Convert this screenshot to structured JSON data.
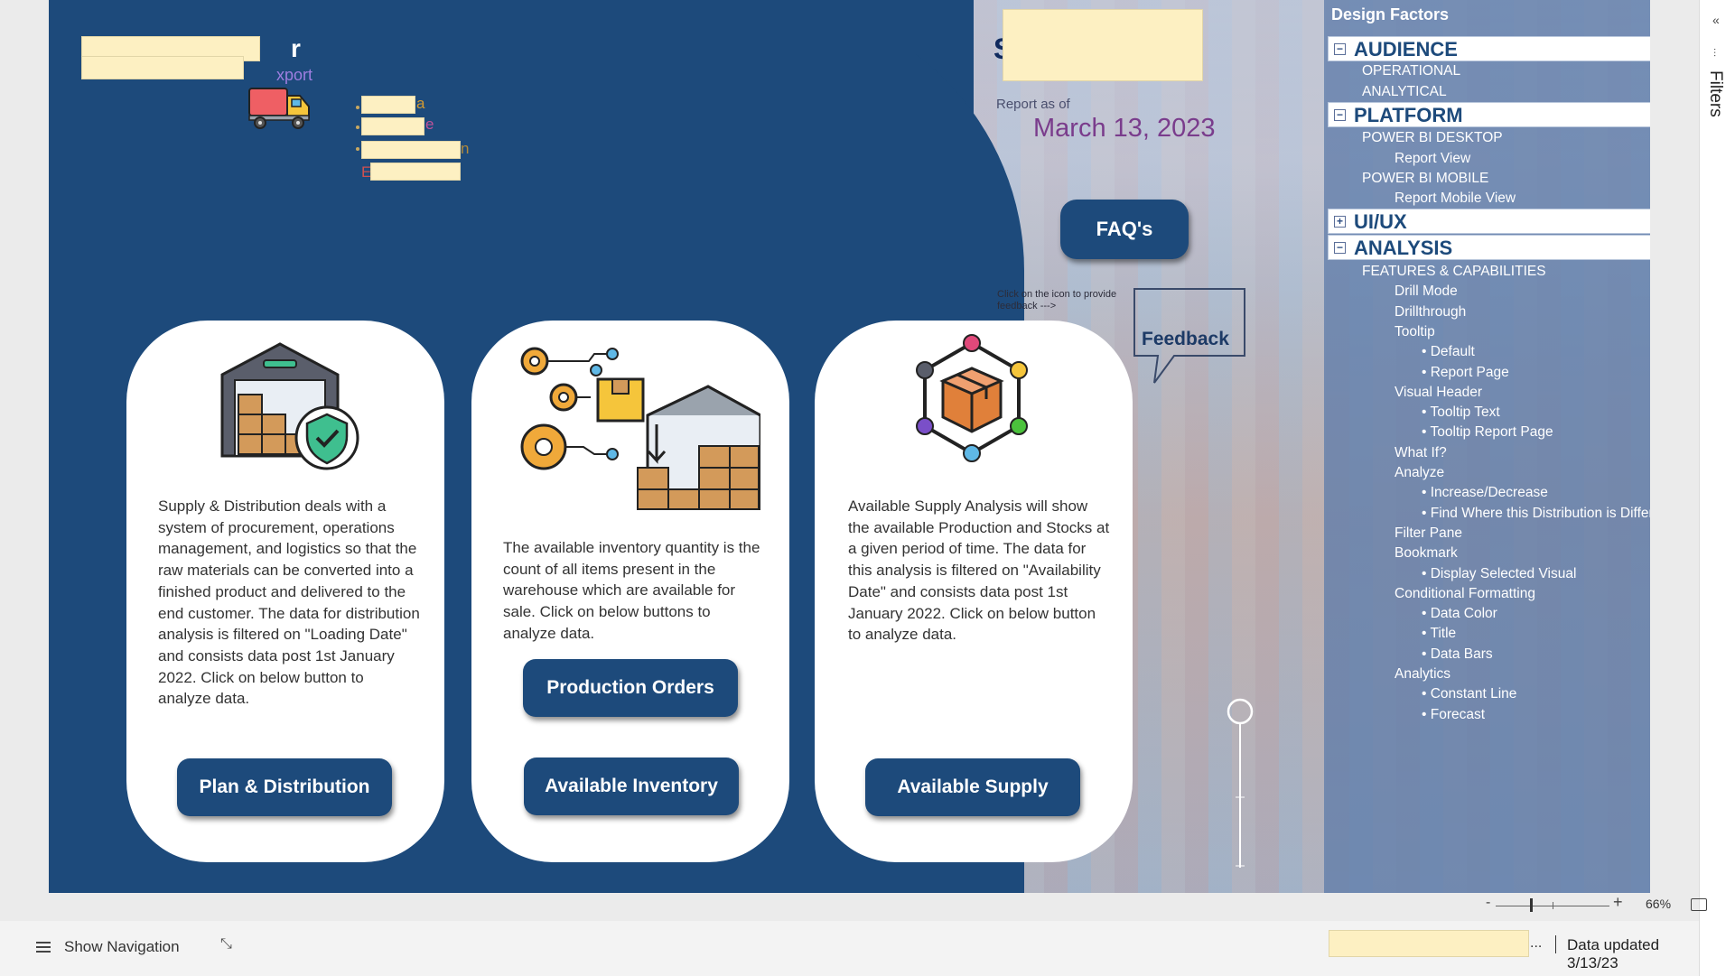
{
  "header": {
    "title_visible_tail": "r",
    "subtitle_visible_tail": "xport",
    "right_title_visible_char": "S",
    "legend_tails": [
      "a",
      "e",
      "n",
      "E"
    ],
    "report_as_of_label": "Report as of",
    "report_date": "March 13, 2023"
  },
  "faq_label": "FAQ's",
  "feedback": {
    "hint": "Click on the icon to provide feedback --->",
    "label": "Feedback"
  },
  "cards": [
    {
      "icon": "warehouse-shield-icon",
      "text": "Supply & Distribution deals with a system of procurement, operations management, and logistics so that the raw materials can be converted into a finished product and delivered to the end customer. The data for distribution analysis is filtered on \"Loading Date\" and consists data post 1st January 2022. Click on below button to analyze data.",
      "buttons": [
        "Plan & Distribution"
      ]
    },
    {
      "icon": "gears-warehouse-icon",
      "text": "The available inventory quantity is the count of all items present in the warehouse which are available for sale. Click on below buttons to analyze data.",
      "buttons": [
        "Production Orders",
        "Available Inventory"
      ]
    },
    {
      "icon": "box-network-icon",
      "text": "Available Supply Analysis will show the available Production and Stocks at a given period of time. The data for this analysis is filtered on \"Availability Date\" and consists data post 1st January 2022. Click on below button to analyze data.",
      "buttons": [
        "Available Supply"
      ]
    }
  ],
  "design_factors": {
    "title": "Design Factors",
    "sections": [
      {
        "toggle": "minus",
        "label": "AUDIENCE"
      },
      {
        "toggle": "minus",
        "label": "PLATFORM"
      },
      {
        "toggle": "plus",
        "label": "UI/UX"
      },
      {
        "toggle": "minus",
        "label": "ANALYSIS"
      }
    ],
    "audience_items": [
      "OPERATIONAL",
      "ANALYTICAL"
    ],
    "platform_items": [
      "POWER BI DESKTOP",
      "Report View",
      "POWER BI MOBILE",
      "Report Mobile View"
    ],
    "analysis_items": [
      "FEATURES & CAPABILITIES",
      "Drill Mode",
      "Drillthrough",
      "Tooltip",
      "• Default",
      "• Report Page",
      "Visual Header",
      "• Tooltip Text",
      "• Tooltip Report Page",
      "What If?",
      "Analyze",
      "• Increase/Decrease",
      "• Find Where this Distribution is Differ...",
      "Filter Pane",
      "Bookmark",
      "• Display Selected Visual",
      "Conditional Formatting",
      "• Data Color",
      "• Title",
      "• Data Bars",
      "Analytics",
      "• Constant Line",
      "• Forecast"
    ]
  },
  "filters_label": "Filters",
  "zoom": {
    "minus": "-",
    "plus": "+",
    "level": "66%"
  },
  "status": {
    "show_navigation": "Show Navigation",
    "ellipsis": "...",
    "data_updated": "Data updated 3/13/23"
  }
}
